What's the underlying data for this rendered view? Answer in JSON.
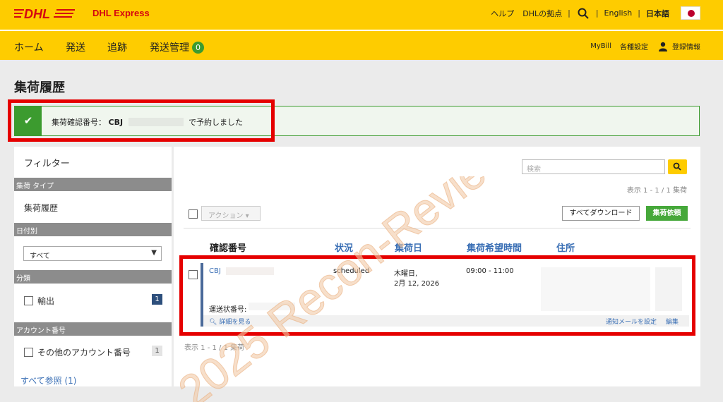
{
  "header": {
    "brand": "DHL Express",
    "links": [
      "ヘルプ",
      "DHLの拠点"
    ],
    "lang_en": "English",
    "lang_ja": "日本語",
    "separator": "|"
  },
  "nav": {
    "items": [
      "ホーム",
      "発送",
      "追跡",
      "発送管理"
    ],
    "badge": "0",
    "right": [
      "MyBill",
      "各種設定",
      "登録情報"
    ]
  },
  "page": {
    "title": "集荷履歴",
    "alert_label": "集荷確認番号：",
    "alert_code": "CBJ",
    "alert_suffix": "で予約しました"
  },
  "sidebar": {
    "filter_title": "フィルター",
    "sec_type": "集荷 タイプ",
    "type_item": "集荷履歴",
    "sec_date": "日付別",
    "date_select": "すべて",
    "sec_class": "分類",
    "class_item": "輸出",
    "class_count": "1",
    "sec_account": "アカウント番号",
    "account_item": "その他のアカウント番号",
    "account_count": "1",
    "see_all": "すべて参照 (1)"
  },
  "content": {
    "search_placeholder": "検索",
    "count_top": "表示 1 - 1 / 1 集荷",
    "action_label": "アクション ▾",
    "download_label": "すべてダウンロード",
    "request_label": "集荷依頼",
    "columns": [
      "確認番号",
      "状況",
      "集荷日",
      "集荷希望時間",
      "住所"
    ],
    "row": {
      "confirm": "CBJ",
      "status": "scheduled",
      "date_line1": "木曜日,",
      "date_line2": "2月 12, 2026",
      "time": "09:00 - 11:00",
      "waybill_label": "運送状番号:",
      "details": "詳細を見る",
      "notify": "通知メールを設定",
      "edit": "編集"
    },
    "count_bottom": "表示 1 - 1 / 1 集荷"
  },
  "watermark": "2025 Recon-ReviewDays",
  "colors": {
    "yellow": "#fecc00",
    "red": "#d40511",
    "green": "#3c9b2f",
    "highlight": "#e50000"
  }
}
